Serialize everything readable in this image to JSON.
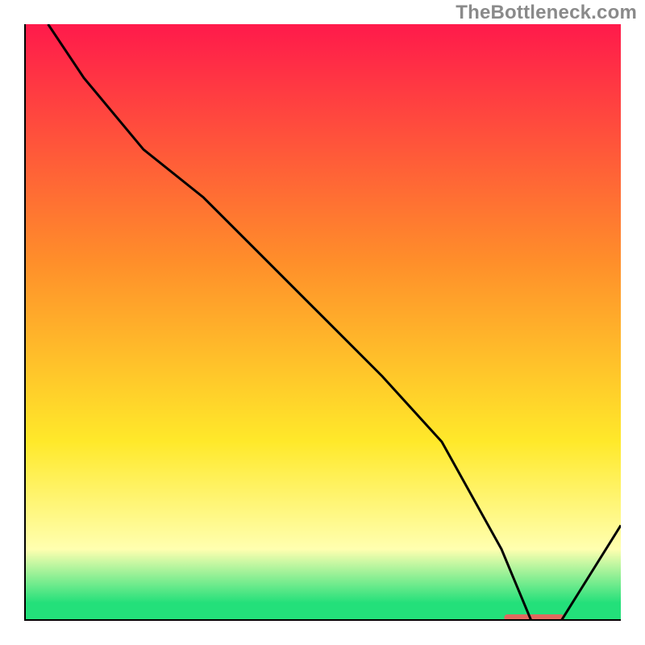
{
  "watermark": "TheBottleneck.com",
  "colors": {
    "red": "#ff1a4b",
    "orange": "#ff8f2a",
    "yellow": "#ffe92a",
    "paleyellow": "#ffffb0",
    "green": "#23e07a",
    "axis": "#000000",
    "line": "#000000",
    "marker": "#e0695e",
    "watermark": "#8a8a8a"
  },
  "chart_data": {
    "type": "line",
    "title": "",
    "xlabel": "",
    "ylabel": "",
    "xlim": [
      0,
      100
    ],
    "ylim": [
      0,
      100
    ],
    "x": [
      4,
      10,
      20,
      30,
      40,
      50,
      60,
      70,
      80,
      85,
      90,
      100
    ],
    "values": [
      100,
      91,
      79,
      71,
      61,
      51,
      41,
      30,
      12,
      0,
      0,
      16
    ],
    "marker_segment": {
      "x0": 81,
      "x1": 90,
      "y": 0
    },
    "gradient_stops": [
      {
        "pos": 0.0,
        "key": "red"
      },
      {
        "pos": 0.4,
        "key": "orange"
      },
      {
        "pos": 0.7,
        "key": "yellow"
      },
      {
        "pos": 0.88,
        "key": "paleyellow"
      },
      {
        "pos": 0.97,
        "key": "green"
      },
      {
        "pos": 1.0,
        "key": "green"
      }
    ]
  }
}
